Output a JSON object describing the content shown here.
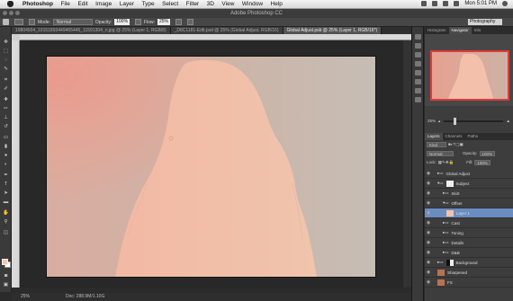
{
  "menubar": {
    "app": "Photoshop",
    "items": [
      "File",
      "Edit",
      "Image",
      "Layer",
      "Type",
      "Select",
      "Filter",
      "3D",
      "View",
      "Window",
      "Help"
    ],
    "clock": "Mon 5:01 PM"
  },
  "titlebar": {
    "title": "Adobe Photoshop CC"
  },
  "options": {
    "mode_label": "Mode:",
    "mode_value": "Normal",
    "opacity_label": "Opacity:",
    "opacity_value": "100%",
    "flow_label": "Flow:",
    "flow_value": "25%",
    "workspace": "Photography"
  },
  "tabs": [
    {
      "label": "19804504_10151893449465445_11591304_n.jpg @ 25% (Layer 1, RGB/8)"
    },
    {
      "label": "_D8C1181-Edit.psd @ 25% (Global Adjust, RGB/16)"
    },
    {
      "label": "Global Adjust.psb @ 25% (Layer 1, RGB/16*)"
    }
  ],
  "status": {
    "zoom": "25%",
    "doc": "Doc: 288.9M/1.10G"
  },
  "panel_tabs_top": [
    "Histogram",
    "Navigator",
    "Info"
  ],
  "navigator_zoom": "25%",
  "panel_tabs_layers": [
    "Layers",
    "Channels",
    "Paths"
  ],
  "layer_controls": {
    "kind": "Kind",
    "blend": "Normal",
    "opacity_label": "Opacity:",
    "opacity_value": "100%",
    "lock_label": "Lock:",
    "fill_label": "Fill:",
    "fill_value": "100%"
  },
  "layers": [
    {
      "name": "Global Adjust"
    },
    {
      "name": "Subject"
    },
    {
      "name": "Skirt"
    },
    {
      "name": "Offset"
    },
    {
      "name": "Layer 1"
    },
    {
      "name": "Cast"
    },
    {
      "name": "Toning"
    },
    {
      "name": "Details"
    },
    {
      "name": "D&B"
    },
    {
      "name": "Background"
    },
    {
      "name": "Sharpened"
    },
    {
      "name": "FS"
    }
  ],
  "colors": {
    "foreground": "#f2c8b2",
    "background": "#ffffff",
    "selected_layer": "#6a8cc0"
  }
}
